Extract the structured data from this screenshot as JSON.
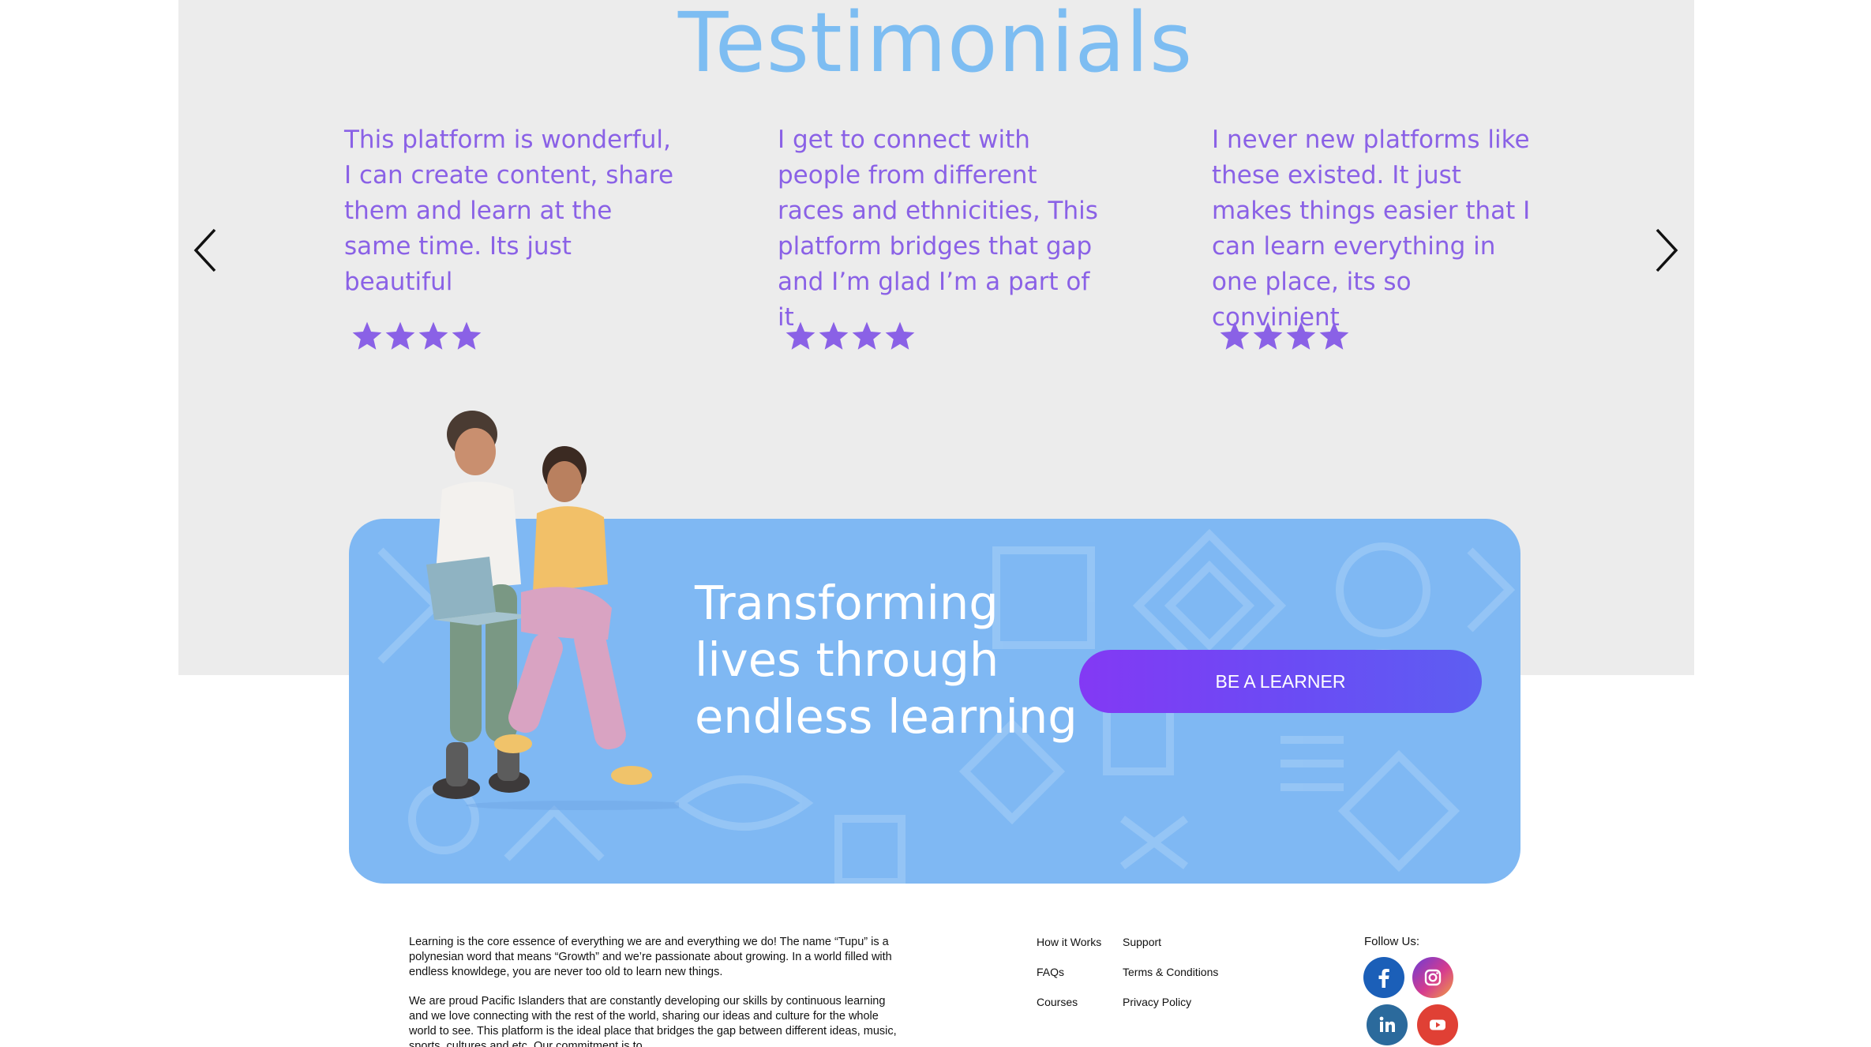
{
  "testimonials": {
    "title": "Testimonials",
    "cards": [
      {
        "text": "This platform is wonderful, I can create content, share them and learn at the same time. Its just beautiful",
        "rating": 4
      },
      {
        "text": "I get to connect with people from different races and ethnicities, This platform bridges that gap and I’m glad I’m a part of it",
        "rating": 4
      },
      {
        "text": "I never new platforms like these existed. It just makes things easier that I can learn everything in one place, its so convinient",
        "rating": 4
      }
    ]
  },
  "banner": {
    "title": "Transforming lives through endless learning",
    "cta_label": "BE A LEARNER"
  },
  "footer": {
    "about_1": "Learning is the core essence of everything we are and everything we do! The name “Tupu” is a polynesian word that means “Growth” and we’re passionate about growing. In a world filled with endless knowldege, you are never too old to learn new things.",
    "about_2": "We are proud Pacific Islanders that are constantly developing our skills by continuous learning and we love connecting with the rest of the world, sharing our ideas and culture for the whole world to see. This platform is the ideal place that bridges the gap between different ideas, music, sports, cultures and etc. Our commitment is to",
    "links_col1": [
      "How it Works",
      "FAQs",
      "Courses"
    ],
    "links_col2": [
      "Support",
      "Terms & Conditions",
      "Privacy Policy"
    ],
    "follow_label": "Follow Us:",
    "social": [
      "facebook-icon",
      "instagram-icon",
      "linkedin-icon",
      "youtube-icon"
    ]
  },
  "colors": {
    "heading": "#7dbdf2",
    "testimonial_text": "#8a61e6",
    "star": "#8a61e6",
    "banner": "#7fb8f3",
    "cta_start": "#8339f4",
    "cta_end": "#5d5ef2"
  }
}
